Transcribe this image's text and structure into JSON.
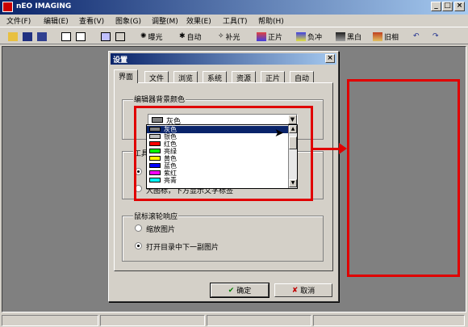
{
  "window": {
    "title": "nEO IMAGING"
  },
  "menu": [
    "文件(F)",
    "编辑(E)",
    "查看(V)",
    "图象(G)",
    "调整(M)",
    "效果(E)",
    "工具(T)",
    "帮助(H)"
  ],
  "toolbar": {
    "exposure": "曝光",
    "auto": "自动",
    "fill": "补光",
    "positive": "正片",
    "negative": "负冲",
    "bw": "黑白",
    "old": "旧相"
  },
  "dialog": {
    "title": "设置",
    "tabs": [
      "界面",
      "文件",
      "浏览",
      "系统",
      "资源",
      "正片",
      "自动"
    ],
    "bg_group_label": "编辑器背景颜色",
    "combo_value": "灰色",
    "dropdown": [
      {
        "label": "灰色",
        "color": "#808080"
      },
      {
        "label": "银色",
        "color": "#c0c0c0"
      },
      {
        "label": "红色",
        "color": "#ff0000"
      },
      {
        "label": "亮绿",
        "color": "#00ff00"
      },
      {
        "label": "黄色",
        "color": "#ffff00"
      },
      {
        "label": "蓝色",
        "color": "#0000ff"
      },
      {
        "label": "紫红",
        "color": "#ff00ff"
      },
      {
        "label": "亮青",
        "color": "#00ffff"
      }
    ],
    "tool_group_label_partial": "工具",
    "tool_option_partial": "大图标，下方显示文字标签",
    "wheel_group_label": "鼠标滚轮响应",
    "wheel_opt1": "缩放图片",
    "wheel_opt2": "打开目录中下一副图片",
    "ok": "确定",
    "cancel": "取消"
  },
  "colors": {
    "annotation_red": "#e00000",
    "title_blue": "#0a246a",
    "canvas_gray": "#808080"
  }
}
